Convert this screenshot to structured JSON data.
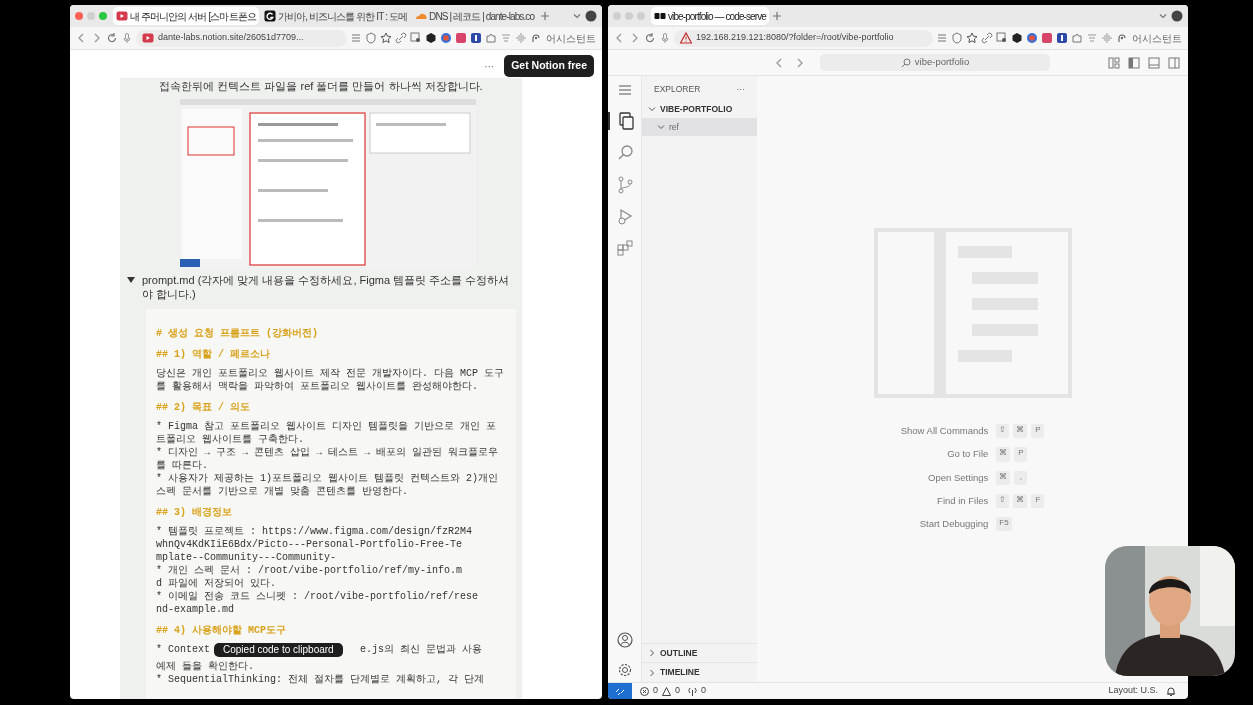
{
  "left_browser": {
    "tabs": [
      {
        "title": "내 주머니안의 서버 [스마트폰으",
        "kind": "video",
        "selected": true
      },
      {
        "title": "가비아, 비즈니스를 위한 IT : 도메",
        "kind": "letter",
        "selected": false
      },
      {
        "title": "DNS | 레코드 | dante-labs.co",
        "kind": "cloud",
        "selected": false
      }
    ],
    "url": "dante-labs.notion.site/26051d7709...",
    "assistant": "어시스턴트"
  },
  "notion": {
    "more": "···",
    "cta": "Get Notion free",
    "intro": "접속한뒤에 컨텍스트 파일을 ref 폴더를 만들어 하나씩 저장합니다.",
    "toggle": {
      "title": "prompt.md (각자에 맞게 내용을 수정하세요,  Figma 템플릿 주소를 수정하셔야 합니다.)",
      "expanded": true
    },
    "code": [
      {
        "kind": "heading",
        "text": "# 생성 요청 프롬프트 (강화버전)"
      },
      {
        "kind": "heading",
        "text": "## 1) 역할 / 페르소나"
      },
      {
        "kind": "para",
        "lines": [
          "당신은 개인 포트폴리오 웹사이트 제작 전문 개발자이다. 다음 MCP 도구",
          "를 활용해서 맥락을 파악하여 포트폴리오 웹사이트를 완성해야한다."
        ]
      },
      {
        "kind": "heading",
        "text": "## 2) 목표 / 의도"
      },
      {
        "kind": "para",
        "lines": [
          "* Figma 참고 포트폴리오 웹사이트 디자인 템플릿을 기반으로 개인 포",
          "트폴리오 웹사이트를 구축한다."
        ]
      },
      {
        "kind": "para",
        "lines": [
          "* 디자인 → 구조 → 콘텐츠 삽입 → 테스트 → 배포의 일관된 워크플로우",
          "를 따른다."
        ]
      },
      {
        "kind": "para",
        "lines": [
          "* 사용자가 제공하는 1)포트폴리오 웹사이트 템플릿 컨텍스트와 2)개인",
          "스펙 문서를 기반으로 개별 맞춤 콘텐츠를 반영한다."
        ]
      },
      {
        "kind": "heading",
        "text": "## 3) 배경정보"
      },
      {
        "kind": "para",
        "lines": [
          "* 템플릿 프로젝트 : https://www.figma.com/design/fzR2M4",
          "whnQv4KdKIiE6Bdx/Picto---Personal-Portfolio-Free-Te",
          "mplate--Community---Community-"
        ]
      },
      {
        "kind": "para",
        "lines": [
          "* 개인 스펙 문서 :  /root/vibe-portfolio/ref/my-info.m",
          "d 파일에 저장되어 있다."
        ]
      },
      {
        "kind": "para",
        "lines": [
          "* 이메일 전송 코드 스니펫 : /root/vibe-portfolio/ref/rese",
          "nd-example.md"
        ]
      },
      {
        "kind": "heading",
        "text": "## 4) 사용해야할 MCP도구"
      },
      {
        "kind": "covered",
        "before": "* Context",
        "after": "e.js의 최신 문법과 사용",
        "lines": [
          "예제 들을 확인한다."
        ]
      },
      {
        "kind": "para",
        "lines": [
          "* SequentialThinking:  전체 절차를 단계별로 계획하고, 각 단계"
        ]
      }
    ],
    "toast": "Copied code to clipboard"
  },
  "right_browser": {
    "tabs": [
      {
        "title": "vibe-portfolio — code-serve",
        "selected": true
      }
    ],
    "url": "192.168.219.121:8080/?folder=/root/vibe-portfolio",
    "assistant": "어시스턴트"
  },
  "vscode": {
    "search": "vibe-portfolio",
    "activity": [
      {
        "kind": "explorer",
        "selected": true
      },
      {
        "kind": "search",
        "selected": false
      },
      {
        "kind": "scm",
        "selected": false
      },
      {
        "kind": "run",
        "selected": false
      },
      {
        "kind": "extensions",
        "selected": false
      }
    ],
    "sidebar": {
      "title": "EXPLORER",
      "more": "···",
      "tree": [
        {
          "label": "VIBE-PORTFOLIO",
          "expanded": true,
          "children": [
            {
              "label": "ref",
              "expanded": true,
              "selected": true
            }
          ]
        }
      ],
      "sections": [
        {
          "label": "OUTLINE",
          "expanded": false
        },
        {
          "label": "TIMELINE",
          "expanded": false
        }
      ]
    },
    "shortcuts": [
      {
        "label": "Show All Commands",
        "keys": [
          "⇧",
          "⌘",
          "P"
        ]
      },
      {
        "label": "Go to File",
        "keys": [
          "⌘",
          "P"
        ]
      },
      {
        "label": "Open Settings",
        "keys": [
          "⌘",
          ","
        ]
      },
      {
        "label": "Find in Files",
        "keys": [
          "⇧",
          "⌘",
          "F"
        ]
      },
      {
        "label": "Start Debugging",
        "keys": [
          "F5"
        ]
      }
    ],
    "status": {
      "errors": "0",
      "warnings": "0",
      "ports": "0",
      "layout": "Layout: U.S."
    }
  }
}
